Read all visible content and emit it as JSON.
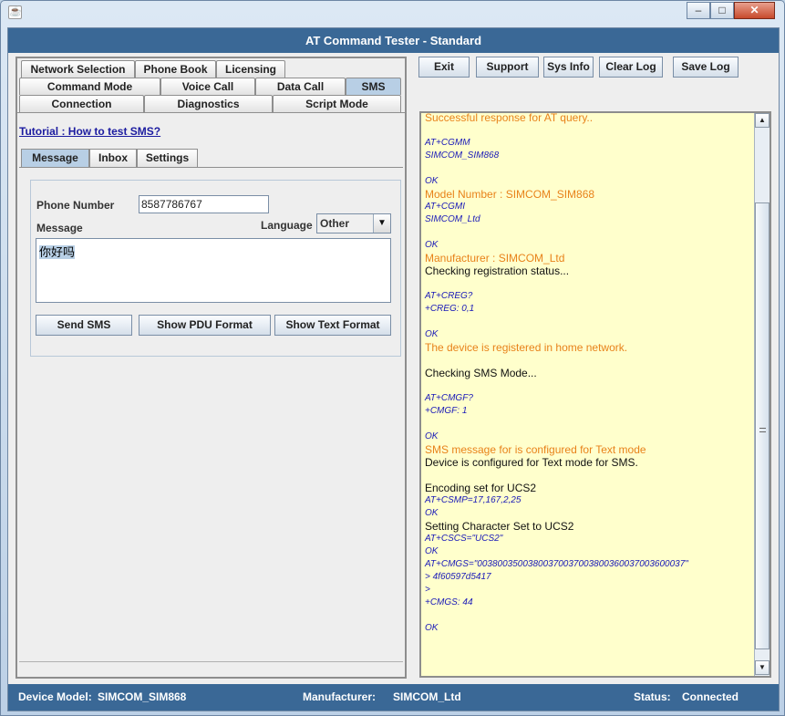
{
  "window": {
    "title": "AT Command Tester - Standard",
    "controls": {
      "minimize": "–",
      "maximize": "□",
      "close": "✕"
    }
  },
  "top_buttons": {
    "exit": "Exit",
    "support": "Support",
    "sys_info": "Sys Info",
    "clear_log": "Clear Log",
    "save_log": "Save Log"
  },
  "tabs": {
    "row1": [
      "Network Selection",
      "Phone Book",
      "Licensing"
    ],
    "row2": [
      "Command Mode",
      "Voice Call",
      "Data Call",
      "SMS"
    ],
    "row3": [
      "Connection",
      "Diagnostics",
      "Script Mode"
    ],
    "selected": "SMS"
  },
  "tutorial_link": "Tutorial : How to test SMS?",
  "sub_tabs": {
    "items": [
      "Message",
      "Inbox",
      "Settings"
    ],
    "selected": "Message"
  },
  "form": {
    "phone_number_label": "Phone Number",
    "phone_number_value": "8587786767",
    "message_label": "Message",
    "language_label": "Language",
    "language_value": "Other",
    "message_value": "你好吗",
    "send_sms": "Send SMS",
    "show_pdu": "Show PDU Format",
    "show_text": "Show Text Format"
  },
  "log": [
    {
      "t": "Successful response for AT query..",
      "c": "orange"
    },
    {
      "t": "",
      "c": "black"
    },
    {
      "t": "AT+CGMM",
      "c": "cmd"
    },
    {
      "t": "SIMCOM_SIM868",
      "c": "cmd"
    },
    {
      "t": "",
      "c": "black"
    },
    {
      "t": "OK",
      "c": "cmd"
    },
    {
      "t": "Model Number : SIMCOM_SIM868",
      "c": "orange"
    },
    {
      "t": "AT+CGMI",
      "c": "cmd"
    },
    {
      "t": "SIMCOM_Ltd",
      "c": "cmd"
    },
    {
      "t": "",
      "c": "black"
    },
    {
      "t": "OK",
      "c": "cmd"
    },
    {
      "t": "Manufacturer : SIMCOM_Ltd",
      "c": "orange"
    },
    {
      "t": "Checking registration status...",
      "c": "black"
    },
    {
      "t": "",
      "c": "black"
    },
    {
      "t": "AT+CREG?",
      "c": "cmd"
    },
    {
      "t": "+CREG: 0,1",
      "c": "cmd"
    },
    {
      "t": "",
      "c": "black"
    },
    {
      "t": "OK",
      "c": "cmd"
    },
    {
      "t": "The device is registered in home network.",
      "c": "orange"
    },
    {
      "t": "",
      "c": "black"
    },
    {
      "t": "Checking SMS Mode...",
      "c": "black"
    },
    {
      "t": "",
      "c": "black"
    },
    {
      "t": "AT+CMGF?",
      "c": "cmd"
    },
    {
      "t": "+CMGF: 1",
      "c": "cmd"
    },
    {
      "t": "",
      "c": "black"
    },
    {
      "t": "OK",
      "c": "cmd"
    },
    {
      "t": "SMS message for is configured for Text mode",
      "c": "orange"
    },
    {
      "t": "Device is configured for Text mode for SMS.",
      "c": "black"
    },
    {
      "t": "",
      "c": "black"
    },
    {
      "t": "Encoding set for UCS2",
      "c": "black"
    },
    {
      "t": "AT+CSMP=17,167,2,25",
      "c": "cmd"
    },
    {
      "t": "OK",
      "c": "cmd"
    },
    {
      "t": "Setting Character Set to UCS2",
      "c": "black"
    },
    {
      "t": "AT+CSCS=\"UCS2\"",
      "c": "cmd"
    },
    {
      "t": "OK",
      "c": "cmd"
    },
    {
      "t": "AT+CMGS=\"00380035003800370037003800360037003600037\"",
      "c": "cmd"
    },
    {
      "t": "> 4f60597d5417",
      "c": "cmd"
    },
    {
      "t": ">",
      "c": "cmd"
    },
    {
      "t": "+CMGS: 44",
      "c": "cmd"
    },
    {
      "t": "",
      "c": "black"
    },
    {
      "t": "OK",
      "c": "cmd"
    }
  ],
  "status": {
    "device_model_label": "Device Model:",
    "device_model_value": "SIMCOM_SIM868",
    "manufacturer_label": "Manufacturer:",
    "manufacturer_value": "SIMCOM_Ltd",
    "status_label": "Status:",
    "status_value": "Connected"
  },
  "colors": {
    "titlebar": "#3a6896",
    "log_bg": "#ffffcc",
    "log_cmd": "#1a1ab8",
    "log_info": "#e8821a",
    "tab_selected": "#b8cfe5"
  }
}
